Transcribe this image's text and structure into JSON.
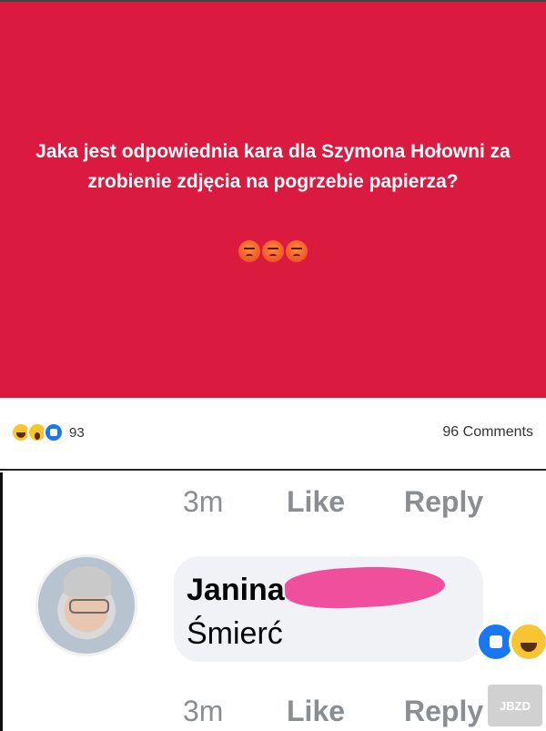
{
  "post": {
    "background_color": "#db1a3f",
    "text": "Jaka jest odpowiednia kara dla Szymona Hołowni za zrobienie zdjęcia na pogrzebie papierza?",
    "emojis": [
      "angry-face-icon",
      "angry-face-icon",
      "angry-face-icon"
    ]
  },
  "stats": {
    "reaction_icons": [
      "haha-reaction-icon",
      "wow-reaction-icon",
      "like-reaction-icon"
    ],
    "reaction_count": "93",
    "comments_count": "96 Comments"
  },
  "comment_actions_top": {
    "time": "3m",
    "like": "Like",
    "reply": "Reply"
  },
  "comment": {
    "author": "Janina",
    "text": "Śmierć",
    "reactions": [
      "like-reaction-icon",
      "haha-reaction-icon"
    ],
    "time": "3m",
    "like": "Like",
    "reply": "Reply"
  },
  "watermark": "JBZD",
  "colors": {
    "accent_like": "#1877f2",
    "scribble": "#ef4f9d"
  }
}
